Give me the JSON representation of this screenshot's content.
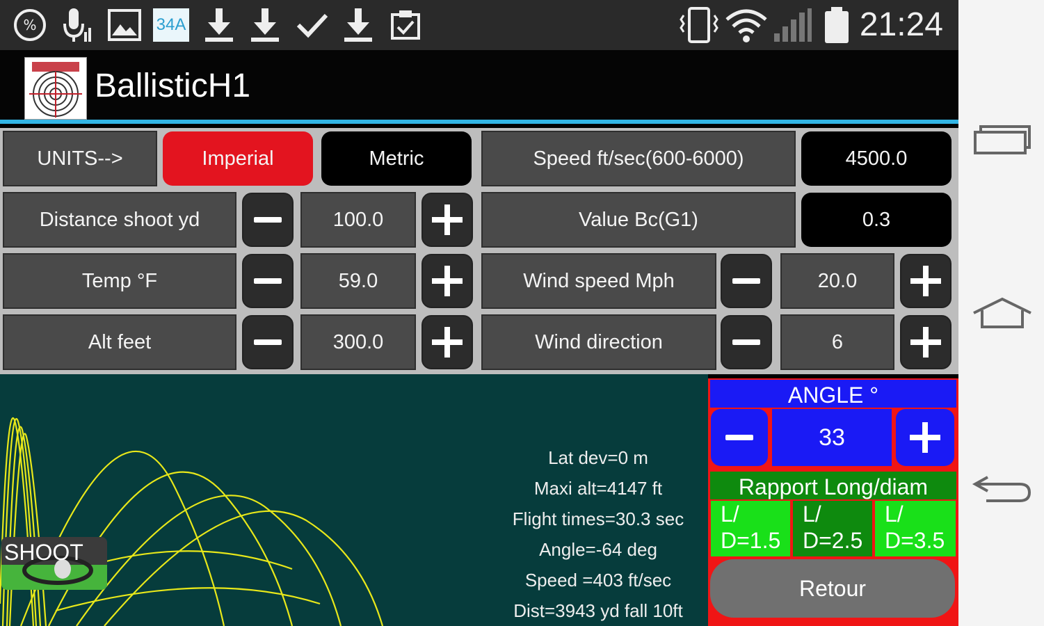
{
  "status_bar": {
    "icons": [
      "data-saver-icon",
      "mic-icon",
      "image-icon",
      "calendar-icon",
      "download-icon",
      "download-icon",
      "check-icon",
      "download-icon",
      "clipboard-check-icon",
      "vibrate-icon",
      "wifi-icon",
      "signal-icon",
      "battery-icon"
    ],
    "calendar_text": "34A",
    "time": "21:24"
  },
  "app": {
    "title": "BallisticH1"
  },
  "units": {
    "label": "UNITS-->",
    "imperial": "Imperial",
    "metric": "Metric",
    "selected": "Imperial"
  },
  "rows": {
    "distance": {
      "label": "Distance shoot yd",
      "value": "100.0"
    },
    "temp": {
      "label": "Temp °F",
      "value": "59.0"
    },
    "alt": {
      "label": "Alt feet",
      "value": "300.0"
    },
    "speed": {
      "label": "Speed ft/sec(600-6000)",
      "value": "4500.0"
    },
    "bc": {
      "label": "Value Bc(G1)",
      "value": "0.3"
    },
    "wind_speed": {
      "label": "Wind speed Mph",
      "value": "20.0"
    },
    "wind_dir": {
      "label": "Wind direction",
      "value": "6"
    }
  },
  "results": {
    "lat_dev": "Lat dev=0 m",
    "maxi_alt": "Maxi alt=4147 ft",
    "flight_time": "Flight times=30.3 sec",
    "angle": "Angle=-64 deg",
    "speed": "Speed =403 ft/sec",
    "dist": "Dist=3943 yd fall 10ft"
  },
  "shoot": {
    "label": "SHOOT"
  },
  "angle_panel": {
    "header": "ANGLE °",
    "value": "33",
    "rapport_header": "Rapport Long/diam",
    "ld_options": [
      "L/\nD=1.5",
      "L/\nD=2.5",
      "L/\nD=3.5"
    ],
    "ld_lines": [
      [
        "L/",
        "D=1.5"
      ],
      [
        "L/",
        "D=2.5"
      ],
      [
        "L/",
        "D=3.5"
      ]
    ],
    "ld_selected": 1,
    "retour": "Retour"
  },
  "colors": {
    "accent_blue": "#33b5e5",
    "imperial_red": "#e3141f",
    "plot_bg": "#063c3c",
    "trajectory": "#e8e81a",
    "angle_blue": "#1a1af5",
    "ld_green": "#19e019",
    "ld_dark_green": "#0e8a0e"
  },
  "nav_bar": {
    "icons": [
      "recent-apps-icon",
      "home-icon",
      "back-icon"
    ]
  }
}
